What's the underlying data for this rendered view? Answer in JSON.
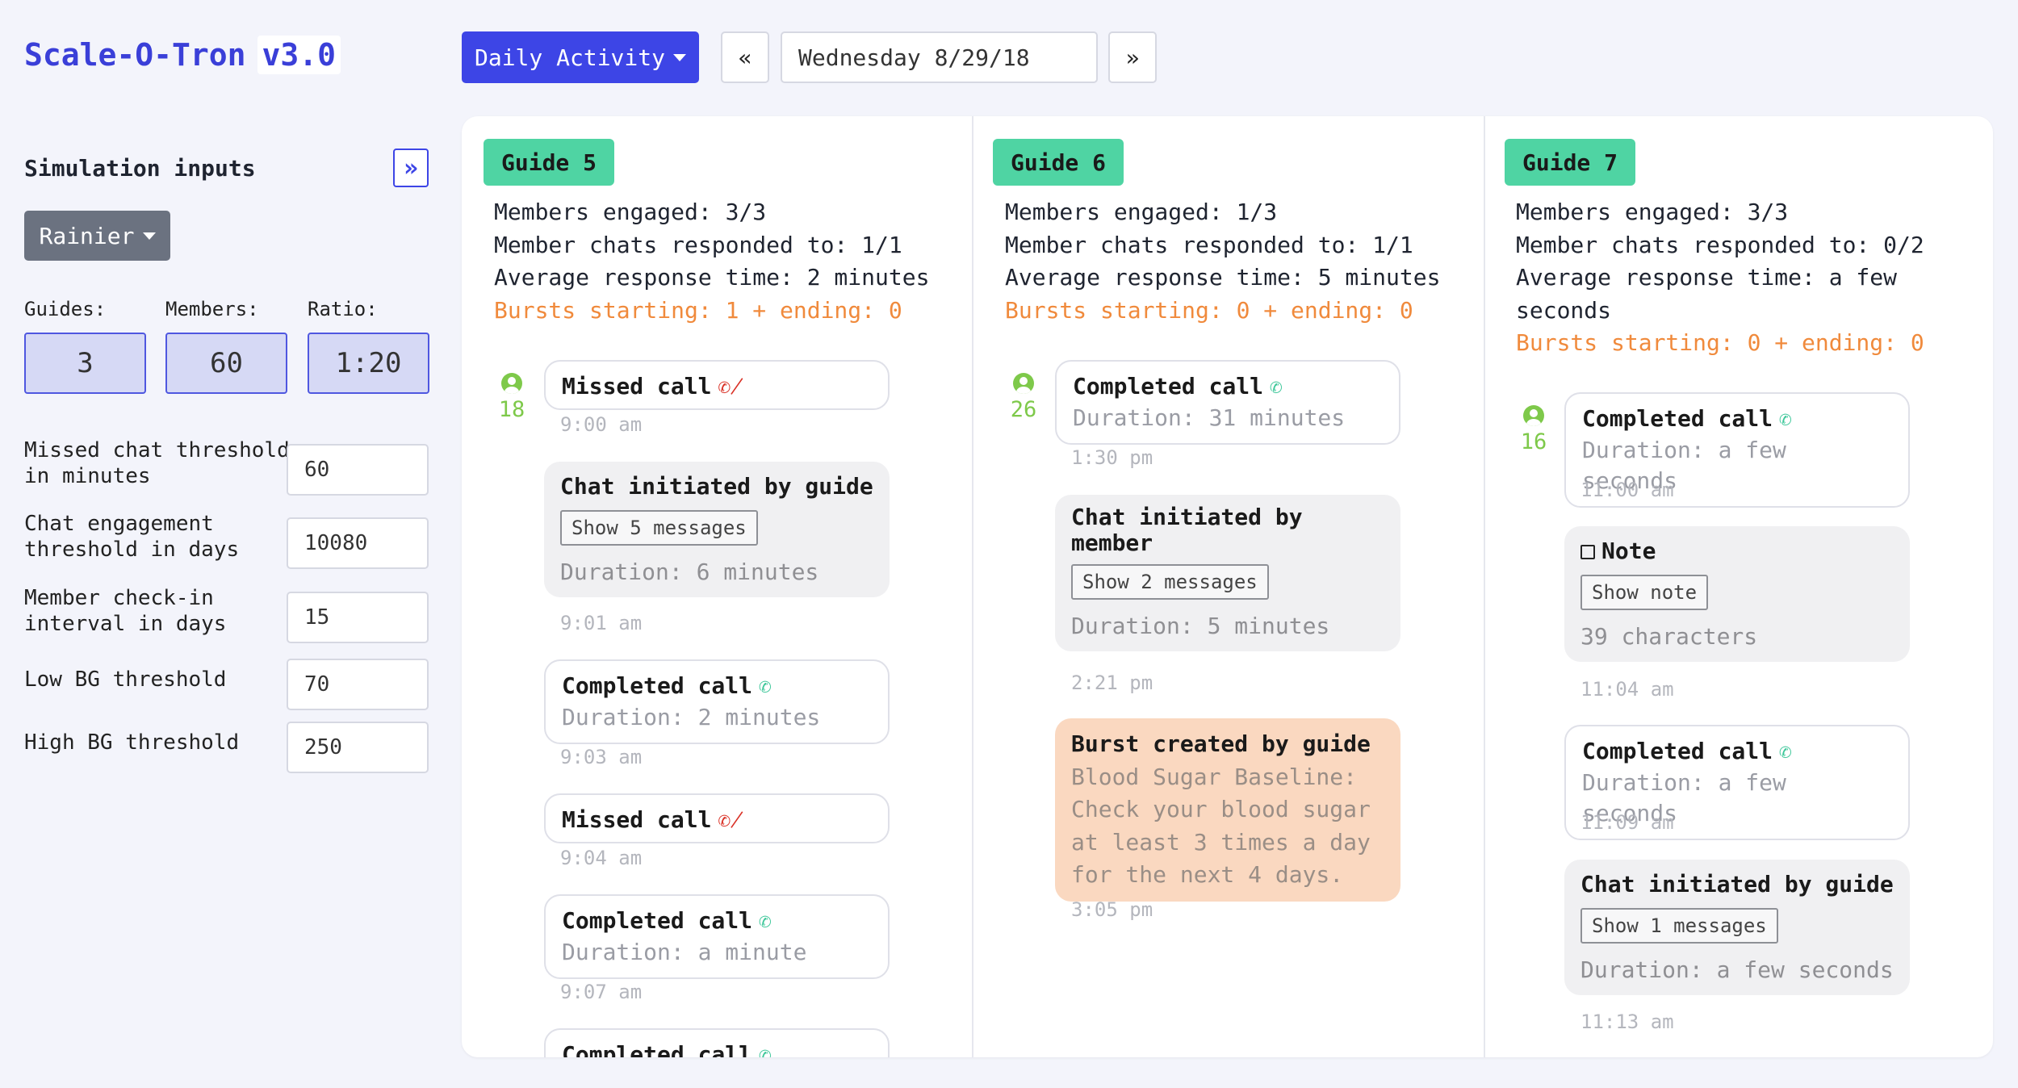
{
  "app": {
    "name": "Scale-O-Tron",
    "version": "v3.0"
  },
  "toolbar": {
    "view": "Daily Activity",
    "prev": "«",
    "next": "»",
    "date": "Wednesday 8/29/18"
  },
  "sidebar": {
    "title": "Simulation inputs",
    "toggle": "»",
    "preset": "Rainier",
    "stats": {
      "guides_label": "Guides:",
      "guides": "3",
      "members_label": "Members:",
      "members": "60",
      "ratio_label": "Ratio:",
      "ratio": "1:20"
    },
    "fields": [
      {
        "label": "Missed chat threshold in minutes",
        "value": "60"
      },
      {
        "label": "Chat engagement threshold in days",
        "value": "10080"
      },
      {
        "label": "Member check-in interval in days",
        "value": "15"
      },
      {
        "label": "Low BG threshold",
        "value": "70"
      },
      {
        "label": "High BG threshold",
        "value": "250"
      }
    ]
  },
  "guides": [
    {
      "name": "Guide 5",
      "stats": [
        "Members engaged: 3/3",
        "Member chats responded to: 1/1",
        "Average response time: 2 minutes",
        "Bursts starting: 1 + ending: 0"
      ],
      "member": "18",
      "events": [
        {
          "title": "Missed call",
          "time": "9:00 am"
        },
        {
          "title": "Chat initiated by guide",
          "button": "Show 5 messages",
          "sub": "Duration: 6 minutes",
          "time": "9:01 am"
        },
        {
          "title": "Completed call",
          "sub": "Duration: 2 minutes",
          "time": "9:03 am"
        },
        {
          "title": "Missed call",
          "time": "9:04 am"
        },
        {
          "title": "Completed call",
          "sub": "Duration: a minute",
          "time": "9:07 am"
        },
        {
          "title": "Completed call"
        }
      ]
    },
    {
      "name": "Guide 6",
      "stats": [
        "Members engaged: 1/3",
        "Member chats responded to: 1/1",
        "Average response time: 5 minutes",
        "Bursts starting: 0 + ending: 0"
      ],
      "member": "26",
      "events": [
        {
          "title": "Completed call",
          "sub": "Duration: 31 minutes",
          "time": "1:30 pm"
        },
        {
          "title": "Chat initiated by member",
          "button": "Show 2 messages",
          "sub": "Duration: 5 minutes",
          "time": "2:21 pm"
        },
        {
          "title": "Burst created by guide",
          "body": "Blood Sugar Baseline: Check your blood sugar at least 3 times a day for the next 4 days.",
          "time": "3:05 pm"
        }
      ]
    },
    {
      "name": "Guide 7",
      "stats": [
        "Members engaged: 3/3",
        "Member chats responded to: 0/2",
        "Average response time: a few seconds",
        "Bursts starting: 0 + ending: 0"
      ],
      "member": "16",
      "events": [
        {
          "title": "Completed call",
          "sub": "Duration: a few seconds",
          "time": "11:00 am"
        },
        {
          "title": "Note",
          "button": "Show note",
          "sub": "39 characters",
          "time": "11:04 am"
        },
        {
          "title": "Completed call",
          "sub": "Duration: a few seconds",
          "time": "11:09 am"
        },
        {
          "title": "Chat initiated by guide",
          "button": "Show 1 messages",
          "sub": "Duration: a few seconds",
          "time": "11:13 am"
        }
      ]
    }
  ]
}
